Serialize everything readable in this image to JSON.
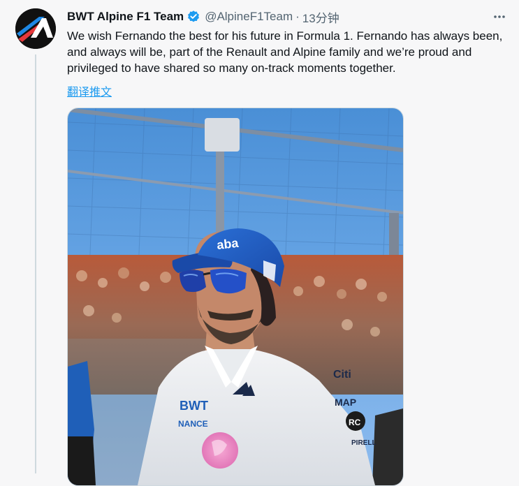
{
  "tweet": {
    "author": {
      "name": "BWT Alpine F1 Team",
      "handle": "@AlpineF1Team",
      "verified": true,
      "avatar_icon": "alpine-logo-icon"
    },
    "separator": "·",
    "time": "13分钟",
    "text": "We wish Fernando the best for his future in Formula 1. Fernando has always been, and always will be, part of the Renault and Alpine family and we’re proud and privileged to have shared so many on-track moments together.",
    "translate_label": "翻译推文",
    "more_icon": "more-options-icon",
    "colors": {
      "link": "#1d9bf0",
      "secondary_text": "#536471",
      "verified_badge": "#1d9bf0",
      "background": "#f7f7f8"
    },
    "media": {
      "cap_text": "aba",
      "sponsor_left": "BWT",
      "sponsor_left_sub": "NANCE",
      "sponsor_right_top": "Citi",
      "sponsor_right_mid": "MAP",
      "sponsor_right_low": "RC",
      "sponsor_right_bottom": "PIRELL"
    }
  }
}
